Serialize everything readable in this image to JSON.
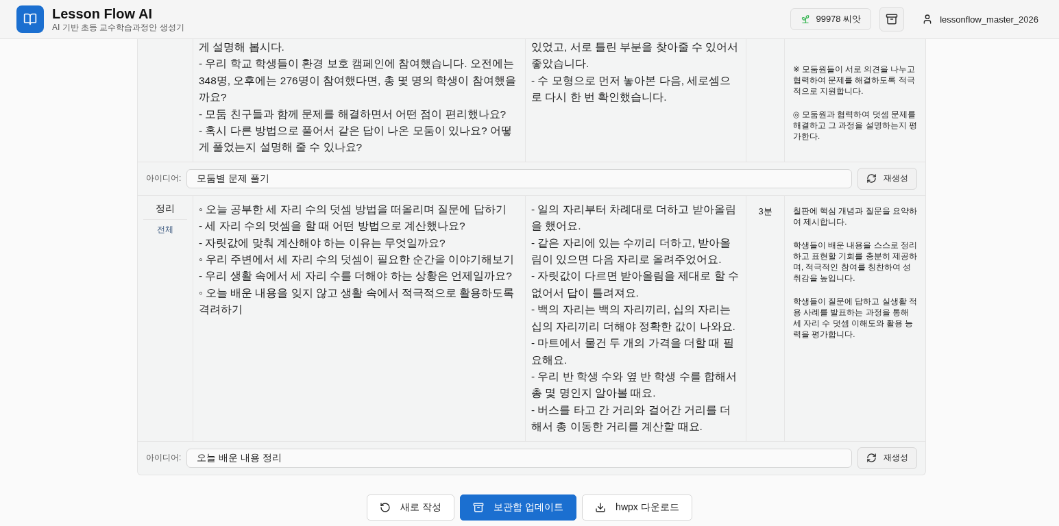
{
  "header": {
    "title": "Lesson Flow AI",
    "subtitle": "AI 기반 초등 교수학습과정안 생성기",
    "seeds": "99978 씨앗",
    "username": "lessonflow_master_2026"
  },
  "sections": [
    {
      "content": "게 설명해 봅시다.\n- 우리 학교 학생들이 환경 보호 캠페인에 참여했습니다. 오전에는 348명, 오후에는 276명이 참여했다면, 총 몇 명의 학생이 참여했을까요?\n- 모둠 친구들과 함께 문제를 해결하면서 어떤 점이 편리했나요?\n- 혹시 다른 방법으로 풀어서 같은 답이 나온 모둠이 있나요? 어떻게 풀었는지 설명해 줄 수 있나요?",
      "examples": "있었고, 서로 틀린 부분을 찾아줄 수 있어서 좋았습니다.\n- 수 모형으로 먼저 놓아본 다음, 세로셈으로 다시 한 번 확인했습니다.",
      "notes": [
        "※ 모둠원들이 서로 의견을 나누고 협력하여 문제를 해결하도록 적극적으로 지원합니다.",
        "◎ 모둠원과 협력하여 덧셈 문제를 해결하고 그 과정을 설명하는지 평가한다."
      ],
      "idea": {
        "label": "아이디어:",
        "value": "모둠별 문제 풀기",
        "button": "재생성"
      }
    },
    {
      "stage": "정리",
      "scope": "전체",
      "content": "◦ 오늘 공부한 세 자리 수의 덧셈 방법을 떠올리며 질문에 답하기\n- 세 자리 수의 덧셈을 할 때 어떤 방법으로 계산했나요?\n- 자릿값에 맞춰 계산해야 하는 이유는 무엇일까요?\n◦ 우리 주변에서 세 자리 수의 덧셈이 필요한 순간을 이야기해보기\n- 우리 생활 속에서 세 자리 수를 더해야 하는 상황은 언제일까요?\n◦ 오늘 배운 내용을 잊지 않고 생활 속에서 적극적으로 활용하도록 격려하기",
      "examples": "- 일의 자리부터 차례대로 더하고 받아올림을 했어요.\n- 같은 자리에 있는 수끼리 더하고, 받아올림이 있으면 다음 자리로 올려주었어요.\n- 자릿값이 다르면 받아올림을 제대로 할 수 없어서 답이 틀려져요.\n- 백의 자리는 백의 자리끼리, 십의 자리는 십의 자리끼리 더해야 정확한 값이 나와요.\n- 마트에서 물건 두 개의 가격을 더할 때 필요해요.\n- 우리 반 학생 수와 옆 반 학생 수를 합해서 총 몇 명인지 알아볼 때요.\n- 버스를 타고 간 거리와 걸어간 거리를 더해서 총 이동한 거리를 계산할 때요.",
      "time": "3분",
      "notes": [
        "칠판에 핵심 개념과 질문을 요약하여 제시합니다.",
        "학생들이 배운 내용을 스스로 정리하고 표현할 기회를 충분히 제공하며, 적극적인 참여를 칭찬하여 성취감을 높입니다.",
        "학생들이 질문에 답하고 실생활 적용 사례를 발표하는 과정을 통해 세 자리 수 덧셈 이해도와 활용 능력을 평가합니다."
      ],
      "idea": {
        "label": "아이디어:",
        "value": "오늘 배운 내용 정리",
        "button": "재생성"
      }
    }
  ],
  "actions": [
    {
      "kind": "reset",
      "label": "새로 작성"
    },
    {
      "kind": "save",
      "label": "보관함 업데이트"
    },
    {
      "kind": "download",
      "label": "hwpx 다운로드"
    }
  ]
}
